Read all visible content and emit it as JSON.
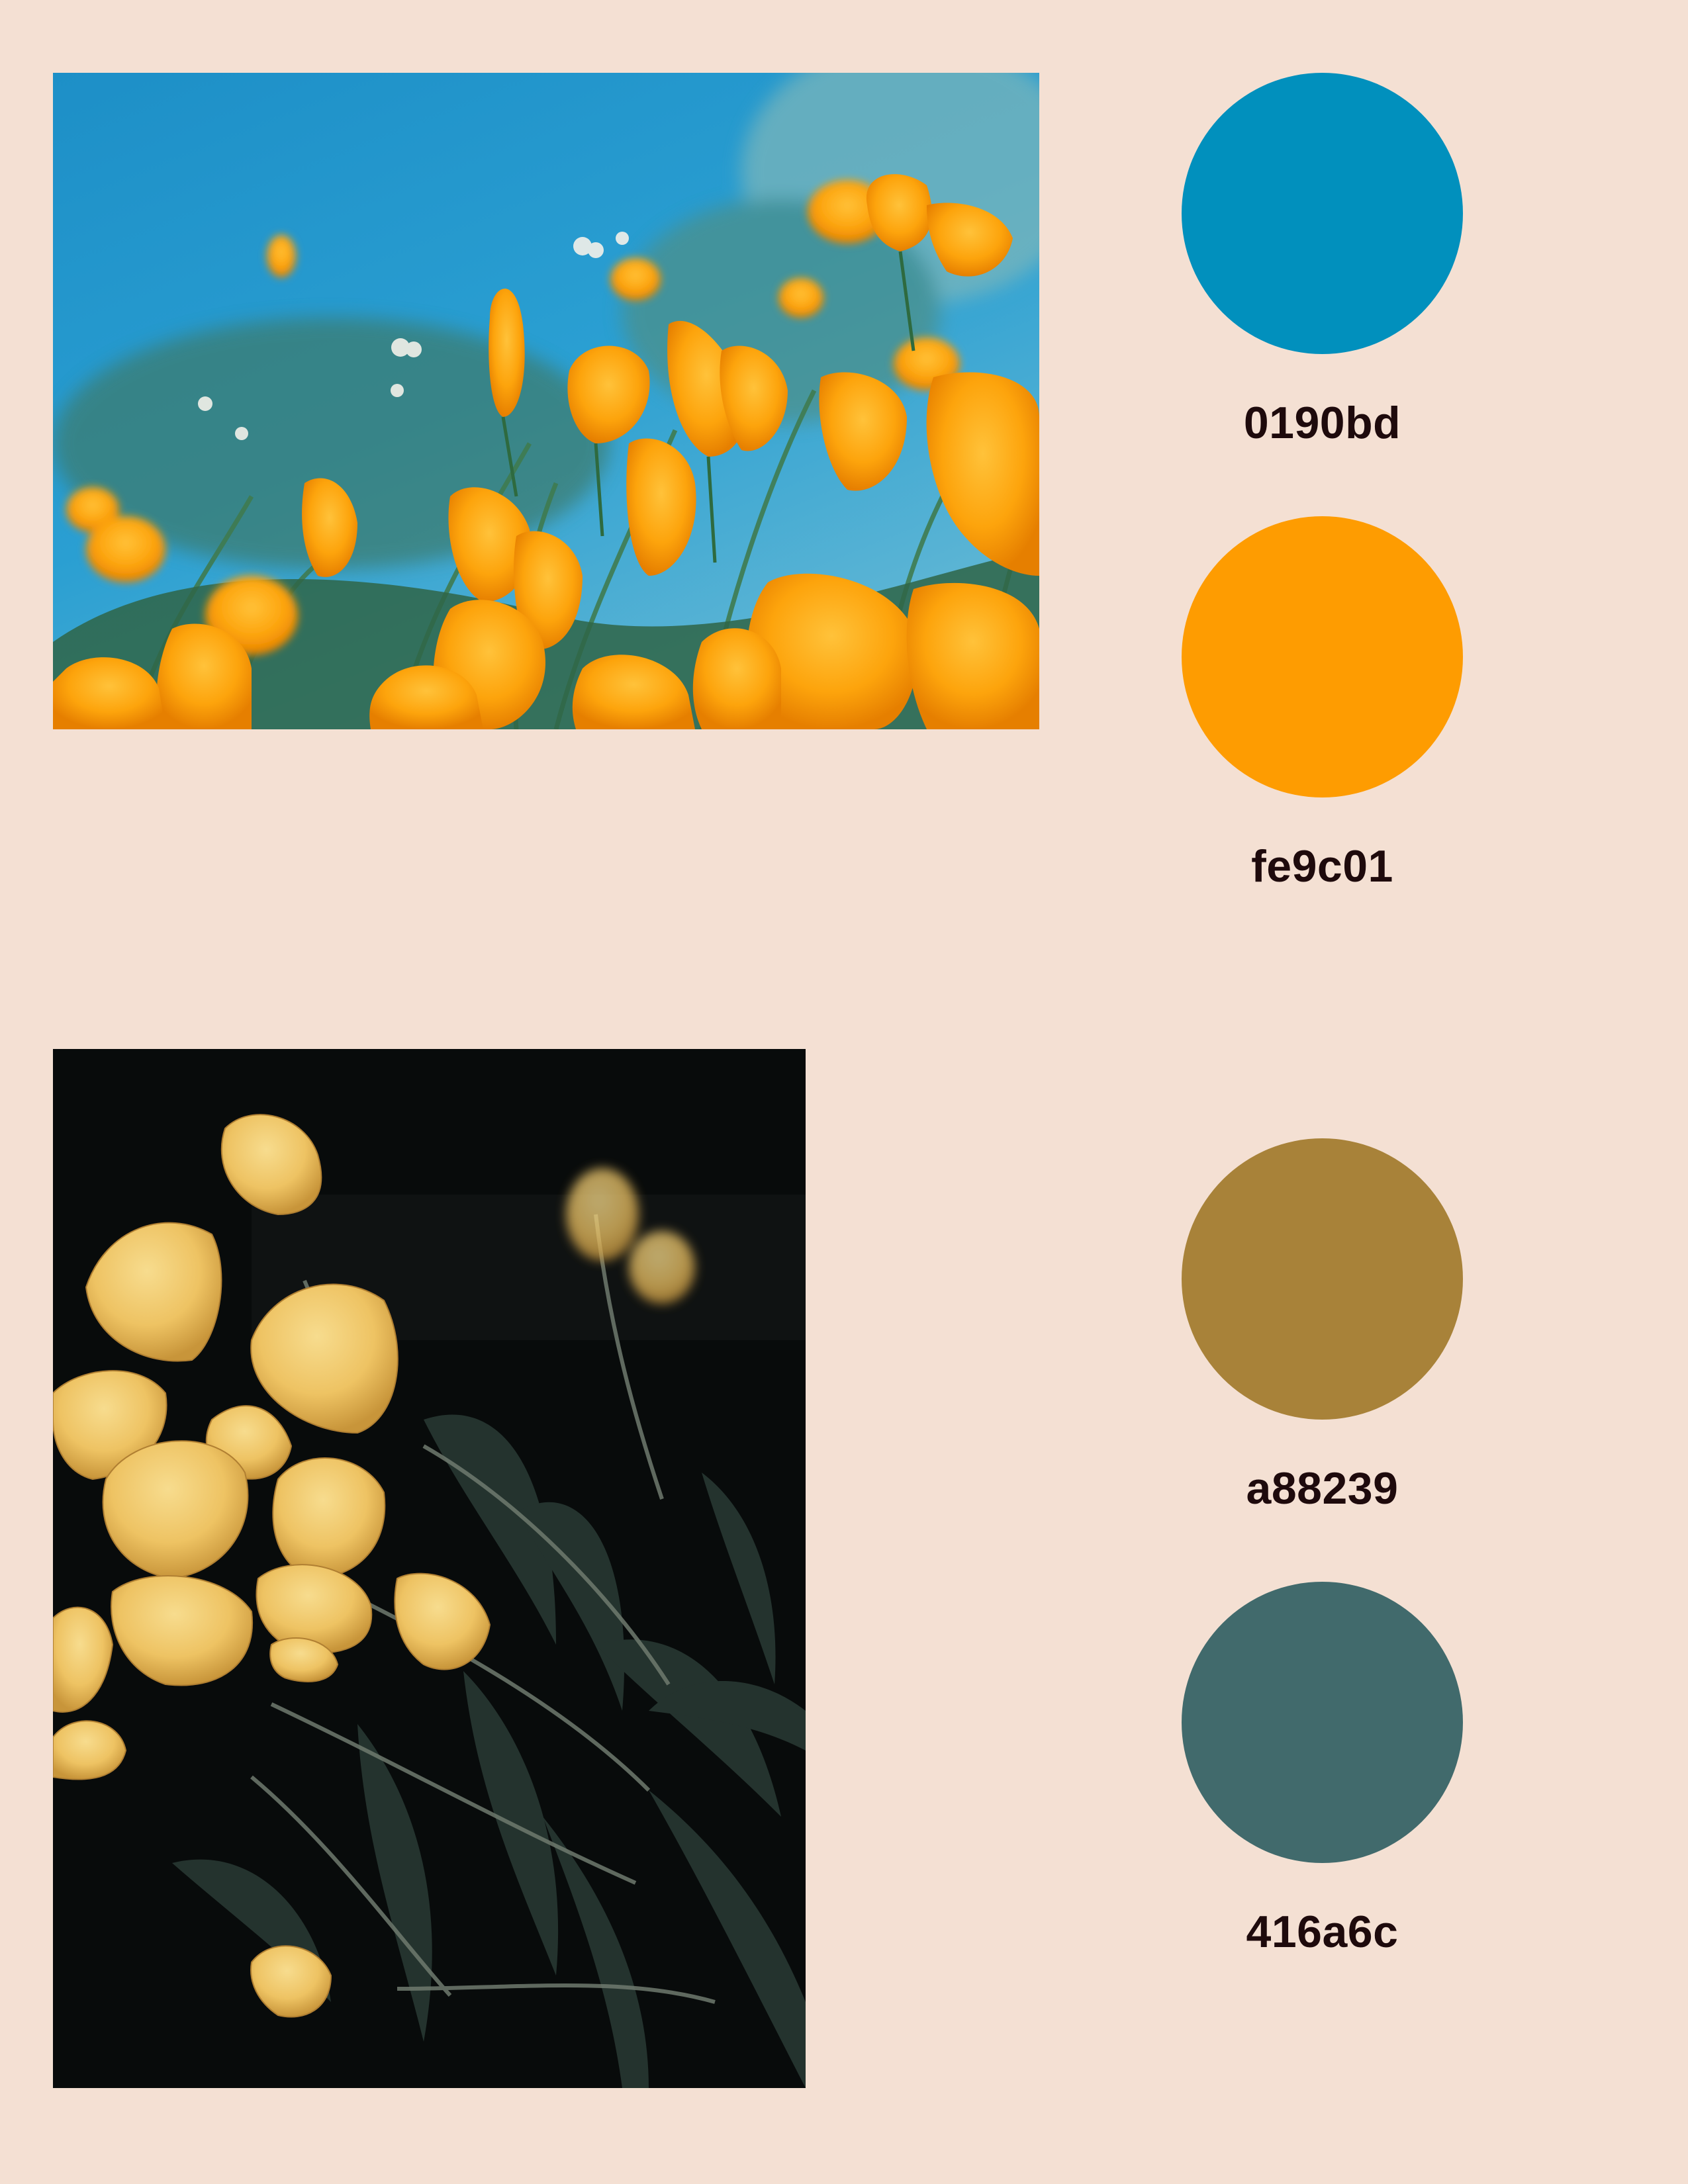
{
  "palettes": [
    {
      "photo": "poppy-field-photo",
      "swatches": [
        {
          "hex": "0190bd",
          "color": "#0190bd"
        },
        {
          "hex": "fe9c01",
          "color": "#fe9c01"
        }
      ]
    },
    {
      "photo": "yellow-tulips-photo",
      "swatches": [
        {
          "hex": "a88239",
          "color": "#a88239"
        },
        {
          "hex": "416a6c",
          "color": "#416a6c"
        }
      ]
    }
  ],
  "background_color": "#f4e0d3",
  "text_color": "#1e0a0c"
}
